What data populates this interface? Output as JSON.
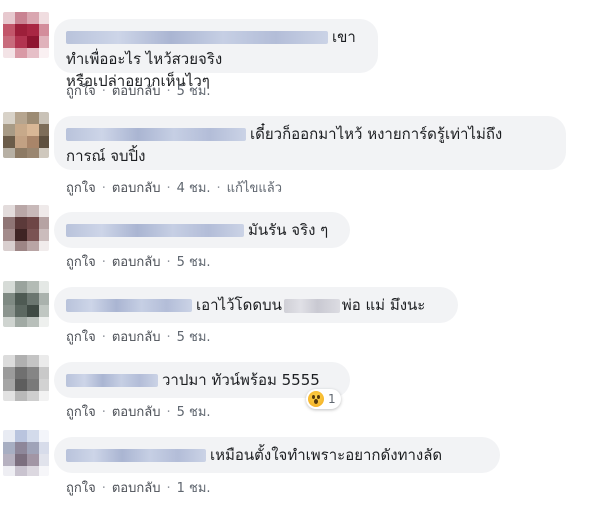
{
  "comments": [
    {
      "text_line1": "เขาทำเพื่ออะไร ไหว้สวยจริง",
      "text_line2": "หรือเปล่าอยากเห็นไวๆ",
      "like": "ถูกใจ",
      "reply": "ตอบกลับ",
      "time": "5 ชม."
    },
    {
      "text_line1": "เดี๋ยวก็ออกมาไหว้ หงายการ์ดรู้เท่าไม่ถึง",
      "text_line2": "การณ์ จบปิ้ง",
      "like": "ถูกใจ",
      "reply": "ตอบกลับ",
      "time": "4 ชม.",
      "edited": "แก้ไขแล้ว"
    },
    {
      "text_line1": "มันรัน จริง ๆ",
      "like": "ถูกใจ",
      "reply": "ตอบกลับ",
      "time": "5 ชม."
    },
    {
      "text_before": "เอาไว้โดดบน",
      "text_after": "พ่อ แม่ มึงนะ",
      "like": "ถูกใจ",
      "reply": "ตอบกลับ",
      "time": "5 ชม."
    },
    {
      "text_line1": "วาปมา ทัวน์พร้อม 5555",
      "like": "ถูกใจ",
      "reply": "ตอบกลับ",
      "time": "5 ชม.",
      "reaction_count": "1",
      "reaction_icon": "wow-reaction-icon"
    },
    {
      "text_line1": "เหมือนตั้งใจทำเพราะอยากดังทางลัด",
      "like": "ถูกใจ",
      "reply": "ตอบกลับ",
      "time": "1 ชม."
    }
  ],
  "colors": {
    "bubble_bg": "#f2f3f5",
    "action_text": "#606770",
    "reaction_wow": "#f3a91d"
  }
}
